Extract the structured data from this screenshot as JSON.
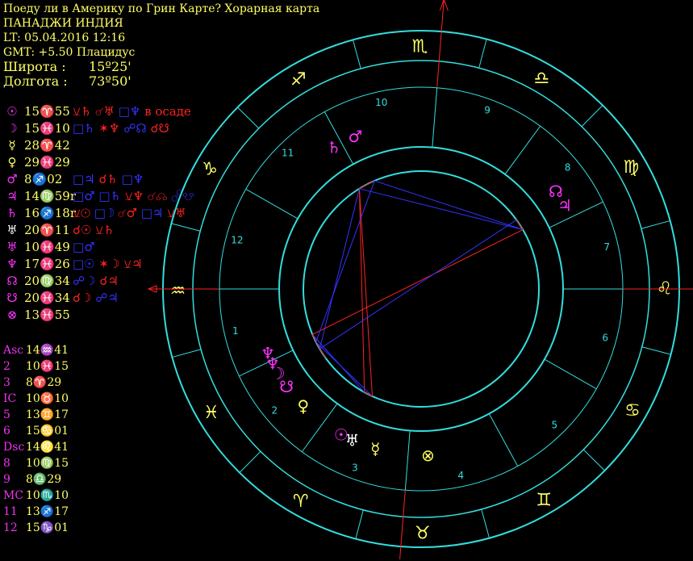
{
  "header": {
    "title": "Поеду ли в Америку по Грин Карте? Хорарная карта",
    "subject": "ПАНАДЖИ ИНДИЯ",
    "lt": "LT: 05.04.2016  12:16",
    "gmt": "GMT: +5.50   Плацидус",
    "latitude_label": "Широта :",
    "latitude_value": "15º25'",
    "longitude_label": "Долгота :",
    "longitude_value": "73º50'"
  },
  "colors": {
    "ring": "#33dddd",
    "header_text": "#ffff66",
    "zodiac_glyph": "#ffff66",
    "planet_white": "#ffffff",
    "planet_magenta": "#ff33ff",
    "aspect_red": "#ff2222",
    "aspect_blue": "#3333ff",
    "axis_red": "#ff2222"
  },
  "planets": [
    {
      "glyph": "☉",
      "pos": "15♈55",
      "glyph_color": "#ff33ff",
      "aspects": [
        {
          "t": "⚺♄",
          "c": "#ff2222"
        },
        {
          "t": " ☌♅ ",
          "c": "#ff2222"
        },
        {
          "t": "□♆",
          "c": "#3333ff"
        },
        {
          "t": " в осаде",
          "c": "#ff2222"
        }
      ]
    },
    {
      "glyph": "☽",
      "pos": "15♓10",
      "glyph_color": "#ff33ff",
      "aspects": [
        {
          "t": "□♄ ",
          "c": "#3333ff"
        },
        {
          "t": "✶♆ ",
          "c": "#ff2222"
        },
        {
          "t": "☍☊ ",
          "c": "#3333ff"
        },
        {
          "t": "☌☋",
          "c": "#ff2222"
        }
      ]
    },
    {
      "glyph": "☿",
      "pos": "28♈42",
      "glyph_color": "#ffff66",
      "aspects": []
    },
    {
      "glyph": "♀",
      "pos": "29♓29",
      "glyph_color": "#ffff66",
      "aspects": []
    },
    {
      "glyph": "♂",
      "pos": "8♐02",
      "glyph_color": "#ff33ff",
      "aspects": [
        {
          "t": "□♃ ",
          "c": "#3333ff"
        },
        {
          "t": "☌♄ ",
          "c": "#ff2222"
        },
        {
          "t": "□♆",
          "c": "#3333ff"
        }
      ]
    },
    {
      "glyph": "♃",
      "pos": "14♍59r",
      "glyph_color": "#ff33ff",
      "aspects": [
        {
          "t": "□♂ ",
          "c": "#3333ff"
        },
        {
          "t": "□♄ ",
          "c": "#3333ff"
        },
        {
          "t": "⚺♆ ",
          "c": "#ff2222"
        },
        {
          "t": "☌☊ ",
          "c": "#ff2222"
        },
        {
          "t": "☍☋",
          "c": "#3333ff"
        }
      ]
    },
    {
      "glyph": "♄",
      "pos": "16♐18r",
      "glyph_color": "#ff33ff",
      "aspects": [
        {
          "t": "⚺☉ ",
          "c": "#ff2222"
        },
        {
          "t": "□☽ ",
          "c": "#3333ff"
        },
        {
          "t": "☌♂ ",
          "c": "#ff2222"
        },
        {
          "t": "□♃ ",
          "c": "#3333ff"
        },
        {
          "t": "⚺♅",
          "c": "#ff2222"
        }
      ]
    },
    {
      "glyph": "♅",
      "pos": "20♈11",
      "glyph_color": "#ffffff",
      "aspects": [
        {
          "t": "☌☉ ",
          "c": "#ff2222"
        },
        {
          "t": "⚺♄",
          "c": "#ff2222"
        }
      ]
    },
    {
      "glyph": "♅",
      "pos": "10♓49",
      "glyph_color": "#ff33ff",
      "aspects": [
        {
          "t": "□♂",
          "c": "#3333ff"
        }
      ]
    },
    {
      "glyph": "♆",
      "pos": "17♓26",
      "glyph_color": "#ff33ff",
      "aspects": [
        {
          "t": "□☉ ",
          "c": "#3333ff"
        },
        {
          "t": "✶☽ ",
          "c": "#ff2222"
        },
        {
          "t": "⚺♃",
          "c": "#ff2222"
        }
      ]
    },
    {
      "glyph": "☊",
      "pos": "20♍34",
      "glyph_color": "#ff33ff",
      "aspects": [
        {
          "t": "☍☽ ",
          "c": "#3333ff"
        },
        {
          "t": "☌♃",
          "c": "#ff2222"
        }
      ]
    },
    {
      "glyph": "☋",
      "pos": "20♓34",
      "glyph_color": "#ff33ff",
      "aspects": [
        {
          "t": "☌☽ ",
          "c": "#ff2222"
        },
        {
          "t": "☍♃",
          "c": "#3333ff"
        }
      ]
    },
    {
      "glyph": "⊗",
      "pos": "13♓55",
      "glyph_color": "#ff33ff",
      "aspects": []
    }
  ],
  "cusps": [
    {
      "label": "Asc",
      "pos": "14♒41"
    },
    {
      "label": "2",
      "pos": "10♓15"
    },
    {
      "label": "3",
      "pos": "8♈29"
    },
    {
      "label": "IC",
      "pos": "10♉10"
    },
    {
      "label": "5",
      "pos": "13♊17"
    },
    {
      "label": "6",
      "pos": "15♋01"
    },
    {
      "label": "Dsc",
      "pos": "14♌41"
    },
    {
      "label": "8",
      "pos": "10♍15"
    },
    {
      "label": "9",
      "pos": "8♎29"
    },
    {
      "label": "MC",
      "pos": "10♏10"
    },
    {
      "label": "11",
      "pos": "13♐17"
    },
    {
      "label": "12",
      "pos": "15♑01"
    }
  ],
  "wheel": {
    "zodiac": [
      {
        "glyph": "♈",
        "lon": 15
      },
      {
        "glyph": "♉",
        "lon": 45
      },
      {
        "glyph": "♊",
        "lon": 75
      },
      {
        "glyph": "♋",
        "lon": 105
      },
      {
        "glyph": "♌",
        "lon": 135
      },
      {
        "glyph": "♍",
        "lon": 165
      },
      {
        "glyph": "♎",
        "lon": 195
      },
      {
        "glyph": "♏",
        "lon": 225
      },
      {
        "glyph": "♐",
        "lon": 255
      },
      {
        "glyph": "♑",
        "lon": 285
      },
      {
        "glyph": "♒",
        "lon": 315
      },
      {
        "glyph": "♓",
        "lon": 345
      }
    ],
    "house_numbers": [
      "1",
      "2",
      "3",
      "4",
      "5",
      "6",
      "7",
      "8",
      "9",
      "10",
      "11",
      "12"
    ],
    "planet_marks": [
      {
        "glyph": "☉",
        "color": "#ff33ff",
        "lon": 15.9
      },
      {
        "glyph": "♅",
        "color": "#ffffff",
        "lon": 20.2
      },
      {
        "glyph": "☿",
        "color": "#ffff66",
        "lon": 28.7
      },
      {
        "glyph": "♀",
        "color": "#ffff66",
        "lon": 359.5
      },
      {
        "glyph": "☋",
        "color": "#ff33ff",
        "lon": 350.6
      },
      {
        "glyph": "☽",
        "color": "#ff33ff",
        "lon": 345.2
      },
      {
        "glyph": "♆",
        "color": "#ff33ff",
        "lon": 341.4
      },
      {
        "glyph": "♆",
        "color": "#ff33ff",
        "lon": 337.4
      },
      {
        "glyph": "♄",
        "color": "#ff33ff",
        "lon": 256.3
      },
      {
        "glyph": "♂",
        "color": "#ff33ff",
        "lon": 248.0
      },
      {
        "glyph": "♃",
        "color": "#ff33ff",
        "lon": 164.9
      },
      {
        "glyph": "☊",
        "color": "#ff33ff",
        "lon": 170.6
      },
      {
        "glyph": "⊗",
        "color": "#ffff66",
        "lon": 47.0
      }
    ]
  }
}
